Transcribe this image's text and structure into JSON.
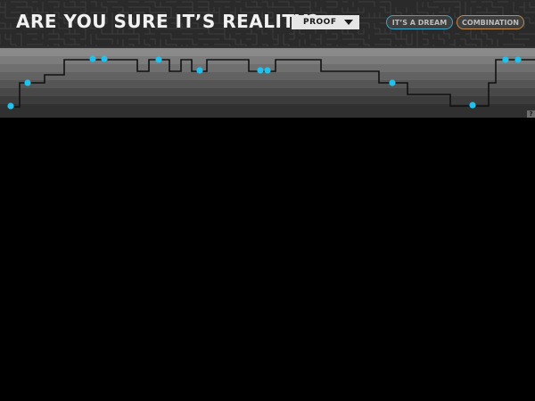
{
  "header": {
    "title": "ARE YOU SURE IT’S REALITY?",
    "dropdown": {
      "selected": "PROOF"
    },
    "buttons": {
      "dream": "IT’S A DREAM",
      "combination": "COMBINATION"
    }
  },
  "help": {
    "label": "?"
  },
  "colors": {
    "header_bg": "#2a2a2a",
    "maze_line": "#3c3c3c",
    "dot": "#1fc2ee",
    "dream_border": "#3aa3c9",
    "combination_border": "#c48a4c",
    "band_colors": [
      "#8a8a8a",
      "#7c7c7c",
      "#6f6f6f",
      "#626262",
      "#555555",
      "#484848",
      "#3c3c3c",
      "#303030"
    ]
  }
}
